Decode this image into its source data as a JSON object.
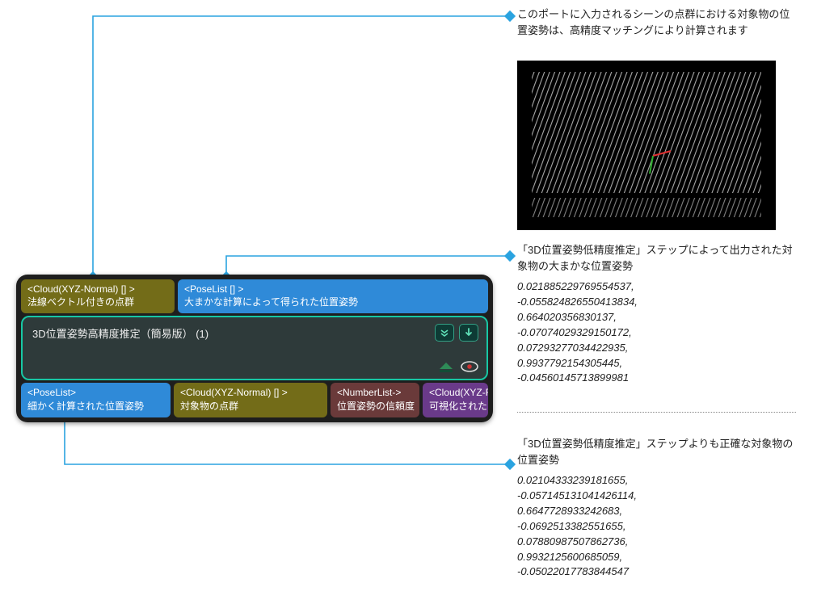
{
  "node": {
    "title": "3D位置姿勢高精度推定（簡易版） (1)",
    "inputs": [
      {
        "type": "<Cloud(XYZ-Normal) [] >",
        "label": "法線ベクトル付きの点群",
        "color": "olive"
      },
      {
        "type": "<PoseList [] >",
        "label": "大まかな計算によって得られた位置姿勢",
        "color": "blue"
      }
    ],
    "outputs": [
      {
        "type": "<PoseList>",
        "label": "細かく計算された位置姿勢",
        "color": "blue"
      },
      {
        "type": "<Cloud(XYZ-Normal) [] >",
        "label": "対象物の点群",
        "color": "olive"
      },
      {
        "type": "<NumberList->",
        "label": "位置姿勢の信頼度",
        "color": "maroon"
      },
      {
        "type": "<Cloud(XYZ-RGB)->",
        "label": "可視化されたカラー点群",
        "color": "purple"
      }
    ],
    "icon_expand_name": "expand-icon",
    "icon_down_name": "arrow-down-icon",
    "icon_eye_name": "visibility-icon",
    "icon_pyramid_name": "layer-icon"
  },
  "annotation_top": {
    "text": "このポートに入力されるシーンの点群における対象物の位置姿勢は、高精度マッチングにより計算されます"
  },
  "annotation_mid": {
    "title": "「3D位置姿勢低精度推定」ステップによって出力された対象物の大まかな位置姿勢",
    "values": [
      "0.021885229769554537,",
      "-0.055824826550413834,",
      "0.664020356830137,",
      "-0.07074029329150172,",
      "0.07293277034422935,",
      "0.9937792154305445,",
      "-0.04560145713899981"
    ]
  },
  "annotation_bot": {
    "title": "「3D位置姿勢低精度推定」ステップよりも正確な対象物の位置姿勢",
    "values": [
      "0.02104333239181655,",
      "-0.057145131041426114,",
      "0.6647728933242683,",
      "-0.0692513382551655,",
      "0.07880987507862736,",
      "0.9932125600685059,",
      "-0.05022017783844547"
    ]
  }
}
